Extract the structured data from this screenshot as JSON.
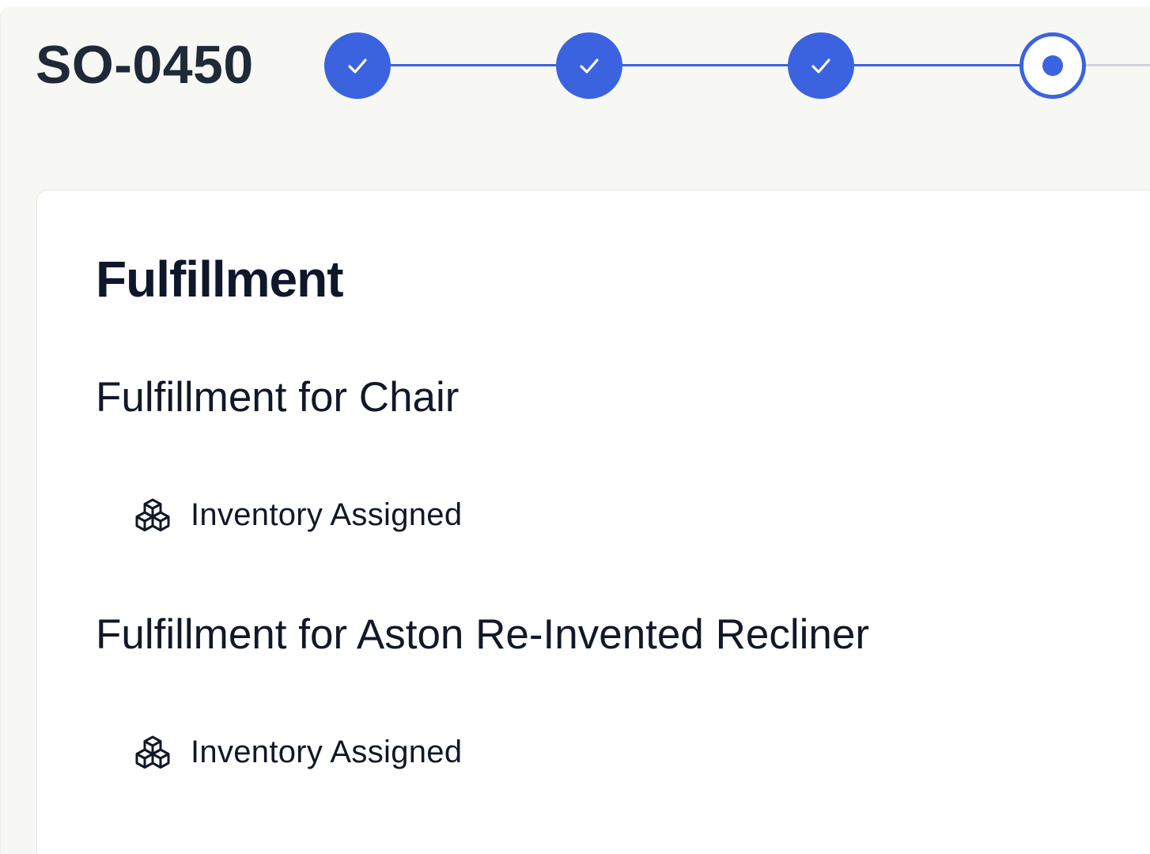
{
  "order": {
    "id": "SO-0450"
  },
  "stepper": {
    "steps": [
      {
        "state": "done",
        "icon": "check-icon"
      },
      {
        "state": "done",
        "icon": "check-icon"
      },
      {
        "state": "done",
        "icon": "check-icon"
      },
      {
        "state": "current",
        "icon": "current-dot-icon"
      }
    ],
    "accent_color": "#3b63e0"
  },
  "card": {
    "title": "Fulfillment",
    "fulfillments": [
      {
        "title": "Fulfillment for Chair",
        "status": "Inventory Assigned",
        "status_icon": "boxes-icon"
      },
      {
        "title": "Fulfillment for Aston Re-Invented Recliner",
        "status": "Inventory Assigned",
        "status_icon": "boxes-icon"
      }
    ]
  }
}
